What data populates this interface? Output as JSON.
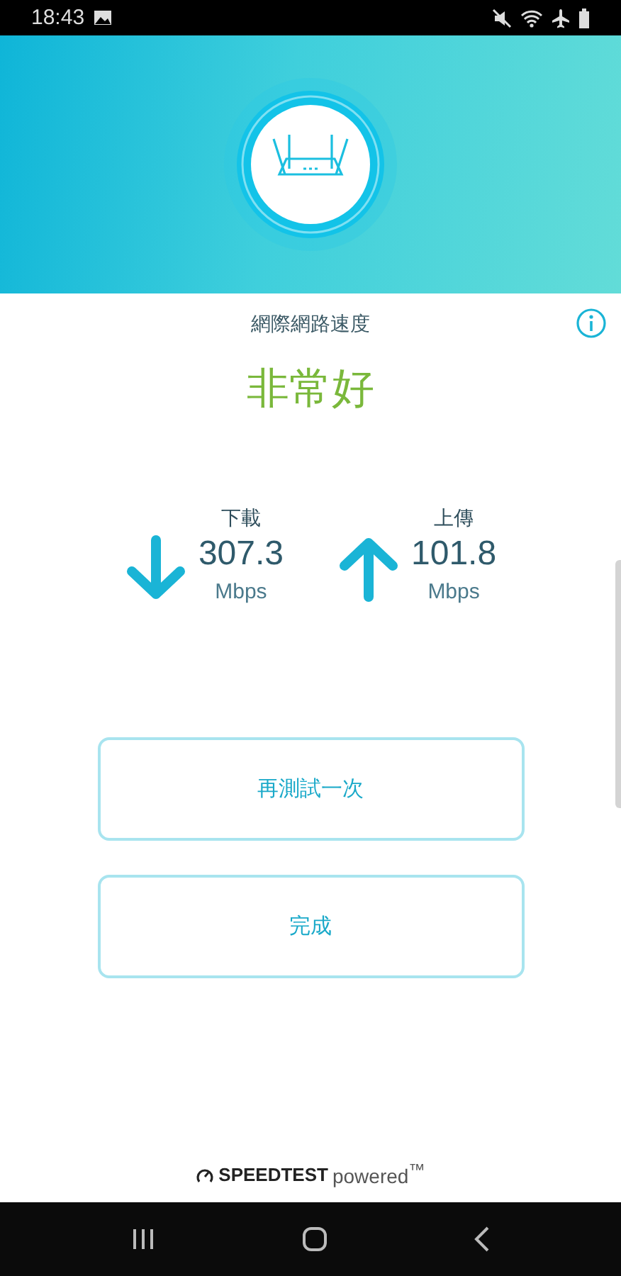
{
  "status_bar": {
    "time": "18:43"
  },
  "result": {
    "title": "網際網路速度",
    "rating": "非常好"
  },
  "stats": [
    {
      "kind": "download",
      "label": "下載",
      "value": "307.3",
      "unit": "Mbps"
    },
    {
      "kind": "upload",
      "label": "上傳",
      "value": "101.8",
      "unit": "Mbps"
    }
  ],
  "buttons": [
    "再測試一次",
    "完成"
  ],
  "footer": {
    "brand": "SPEEDTEST",
    "suffix": "powered$^{™}$"
  }
}
